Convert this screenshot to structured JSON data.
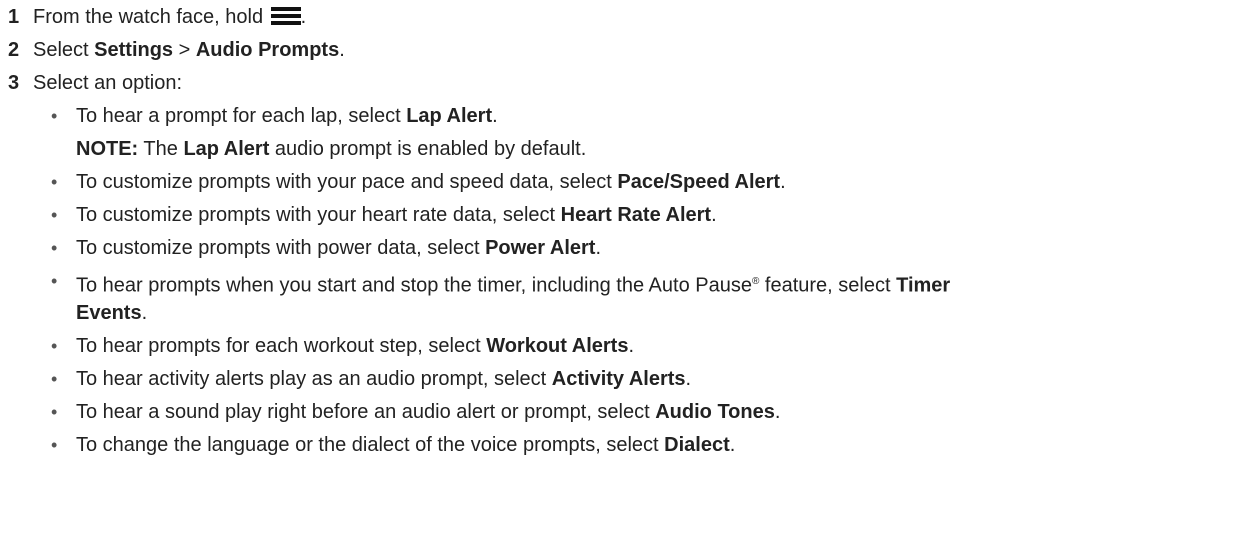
{
  "steps": [
    {
      "num": "1",
      "pre": "From the watch face, hold ",
      "icon": "menu-icon",
      "post": "."
    },
    {
      "num": "2",
      "pre": "Select ",
      "b1": "Settings",
      "mid": " > ",
      "b2": "Audio Prompts",
      "post": "."
    },
    {
      "num": "3",
      "text": "Select an option:"
    }
  ],
  "options": [
    {
      "pre": "To hear a prompt for each lap, select ",
      "bold": "Lap Alert",
      "post": "."
    },
    {
      "pre": "To customize prompts with your pace and speed data, select ",
      "bold": "Pace/Speed Alert",
      "post": "."
    },
    {
      "pre": "To customize prompts with your heart rate data, select ",
      "bold": "Heart Rate Alert",
      "post": "."
    },
    {
      "pre": "To customize prompts with power data, select ",
      "bold": "Power Alert",
      "post": "."
    },
    {
      "pre": "To hear prompts when you start and stop the timer, including the Auto Pause",
      "sup": "®",
      "mid": " feature, select ",
      "bold1": "Timer",
      "bold2": "Events",
      "post": "."
    },
    {
      "pre": "To hear prompts for each workout step, select ",
      "bold": "Workout Alerts",
      "post": "."
    },
    {
      "pre": "To hear activity alerts play as an audio prompt, select ",
      "bold": "Activity Alerts",
      "post": "."
    },
    {
      "pre": "To hear a sound play right before an audio alert or prompt, select ",
      "bold": "Audio Tones",
      "post": "."
    },
    {
      "pre": "To change the language or the dialect of the voice prompts, select ",
      "bold": "Dialect",
      "post": "."
    }
  ],
  "note": {
    "label": "NOTE:",
    "pre": " The ",
    "bold": "Lap Alert",
    "post": " audio prompt is enabled by default."
  },
  "bullet_char": "•"
}
